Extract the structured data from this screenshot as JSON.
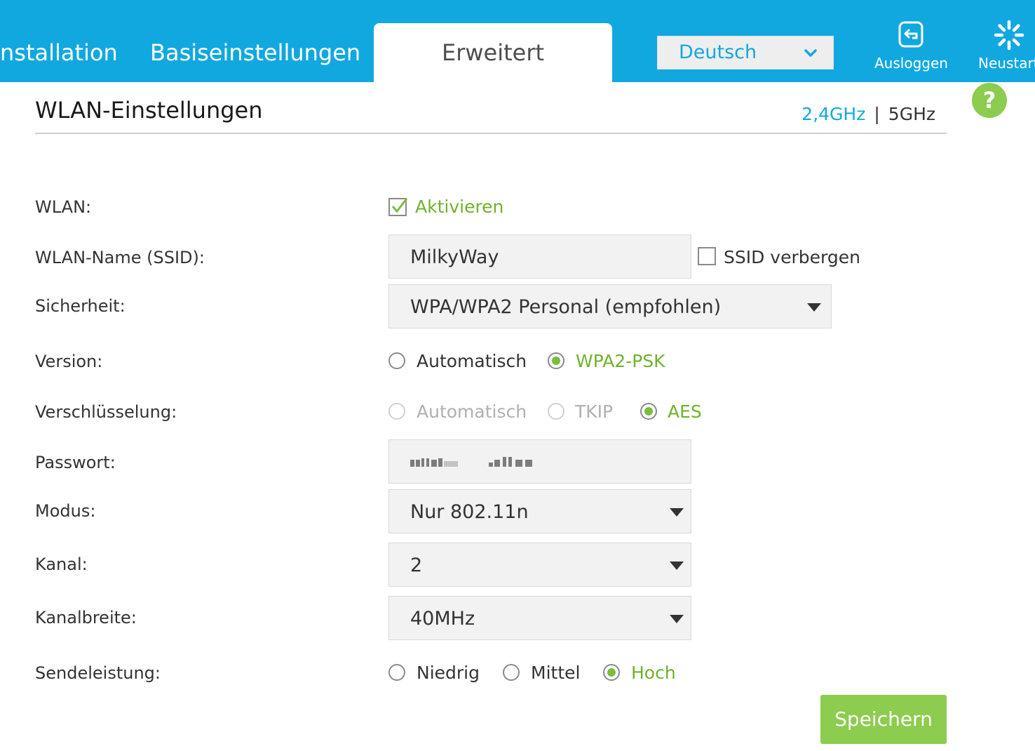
{
  "nav": {
    "tabs": [
      "nstallation",
      "Basiseinstellungen",
      "Erweitert"
    ],
    "active_tab": "Erweitert",
    "language": "Deutsch",
    "logout_label": "Ausloggen",
    "restart_label": "Neustart"
  },
  "section": {
    "title": "WLAN-Einstellungen",
    "band_24": "2,4GHz",
    "band_sep": "|",
    "band_5": "5GHz"
  },
  "form": {
    "wlan": {
      "label": "WLAN:",
      "checkbox_label": "Aktivieren",
      "checked": true
    },
    "ssid": {
      "label": "WLAN-Name (SSID):",
      "value": "MilkyWay",
      "hide_label": "SSID verbergen",
      "hide_checked": false
    },
    "security": {
      "label": "Sicherheit:",
      "value": "WPA/WPA2 Personal (empfohlen)"
    },
    "version": {
      "label": "Version:",
      "options": [
        "Automatisch",
        "WPA2-PSK"
      ],
      "selected": "WPA2-PSK"
    },
    "encryption": {
      "label": "Verschlüsselung:",
      "options": [
        "Automatisch",
        "TKIP",
        "AES"
      ],
      "selected": "AES"
    },
    "password": {
      "label": "Passwort:"
    },
    "mode": {
      "label": "Modus:",
      "value": "Nur 802.11n"
    },
    "channel": {
      "label": "Kanal:",
      "value": "2"
    },
    "bandwidth": {
      "label": "Kanalbreite:",
      "value": "40MHz"
    },
    "tx_power": {
      "label": "Sendeleistung:",
      "options": [
        "Niedrig",
        "Mittel",
        "Hoch"
      ],
      "selected": "Hoch"
    }
  },
  "actions": {
    "save_label": "Speichern",
    "help_label": "?"
  },
  "colors": {
    "header": "#11a8e0",
    "accent_green": "#8ccc4f",
    "selected_text": "#6fb22c"
  },
  "icons": {
    "logout": "logout-icon",
    "restart": "restart-spinner-icon",
    "language_chevron": "chevron-down-icon"
  }
}
